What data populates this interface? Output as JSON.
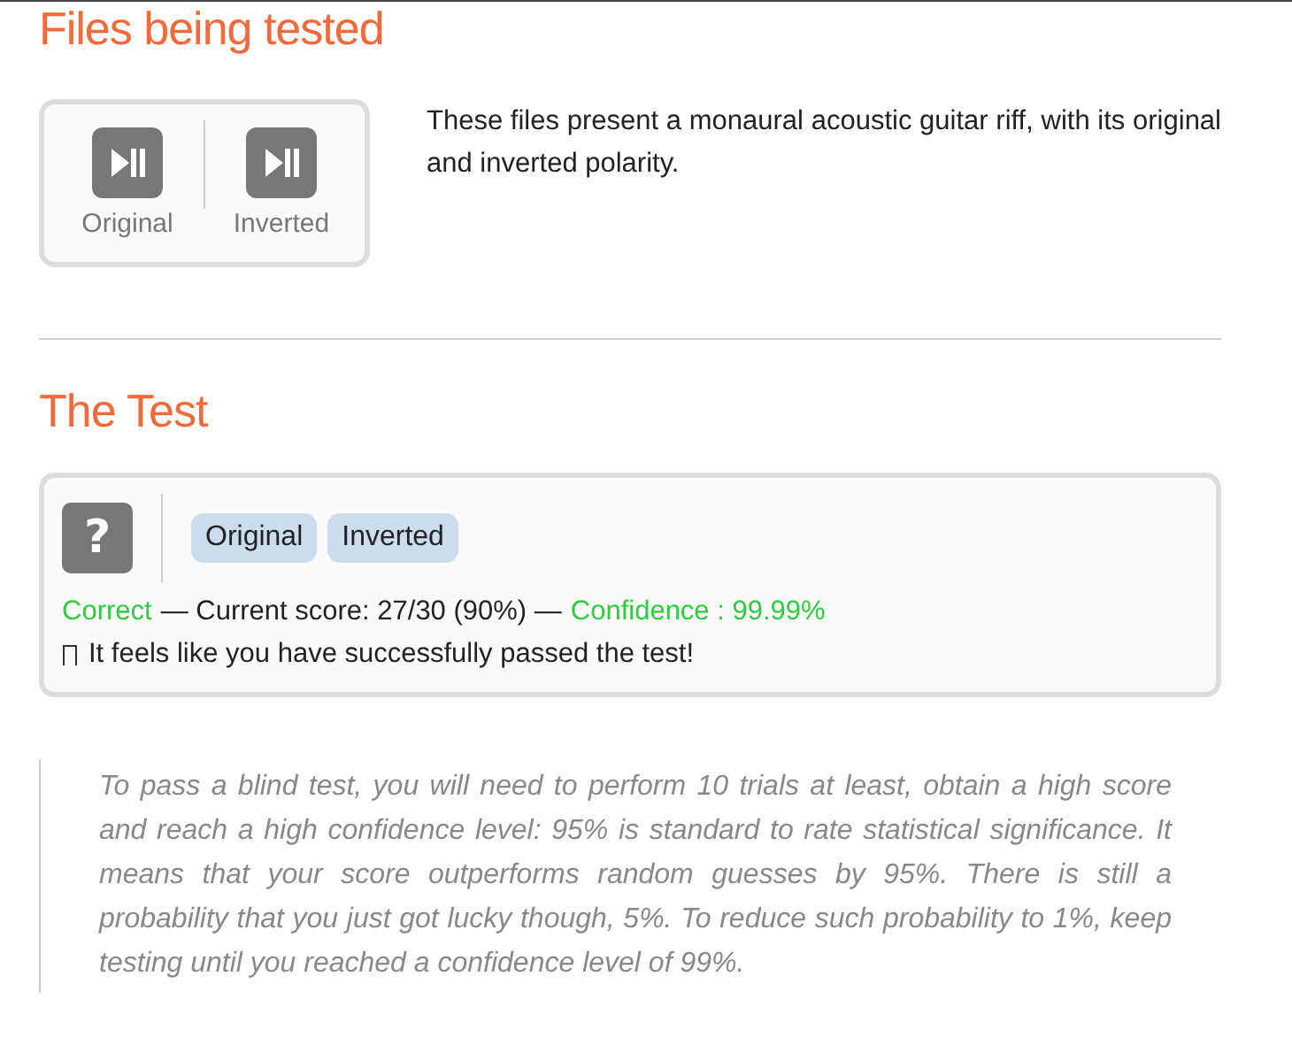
{
  "files_section": {
    "title": "Files being tested",
    "players": [
      {
        "label": "Original"
      },
      {
        "label": "Inverted"
      }
    ],
    "description": "These files present a monaural acoustic guitar riff, with its original and inverted polarity."
  },
  "test_section": {
    "title": "The Test",
    "mystery_button": "?",
    "choices": [
      {
        "label": "Original"
      },
      {
        "label": "Inverted"
      }
    ],
    "status": [
      {
        "text": "Correct",
        "kind": "good"
      },
      {
        "text": "— Current score: 27/30 (90%) —",
        "kind": "plain"
      },
      {
        "text": "Confidence : 99.99%",
        "kind": "good"
      }
    ],
    "verdict": "It feels like you have successfully passed the test!"
  },
  "note": "To pass a blind test, you will need to perform 10 trials at least, obtain a high score and reach a high confidence level: 95% is standard to rate statistical significance. It means that your score outperforms random guesses by 95%. There is still a probability that you just got lucky though, 5%. To reduce such probability to 1%, keep testing until you reached a confidence level of 99%."
}
